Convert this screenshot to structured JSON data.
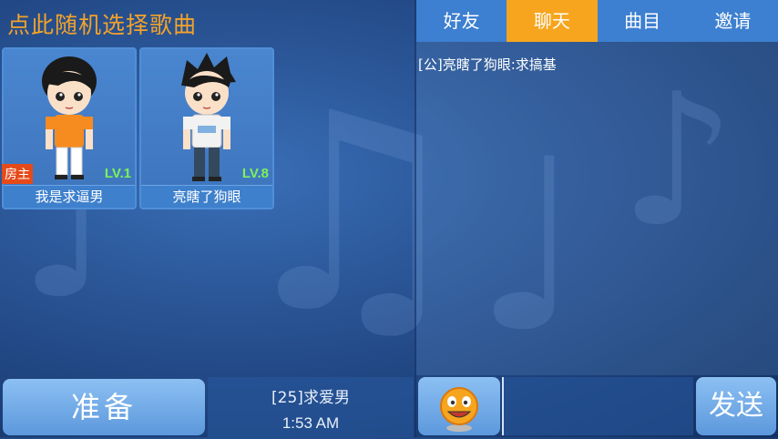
{
  "header": {
    "title": "点此随机选择歌曲"
  },
  "players": [
    {
      "name": "我是求逼男",
      "level": "LV.1",
      "badge": "房主"
    },
    {
      "name": "亮瞎了狗眼",
      "level": "LV.8",
      "badge": ""
    }
  ],
  "tabs": [
    {
      "label": "好友",
      "active": false
    },
    {
      "label": "聊天",
      "active": true
    },
    {
      "label": "曲目",
      "active": false
    },
    {
      "label": "邀请",
      "active": false
    }
  ],
  "chat": {
    "messages": [
      "[公]亮瞎了狗眼:求搞基"
    ]
  },
  "bottom": {
    "ready_label": "准备",
    "status_text": "[25]求爱男",
    "clock": "1:53 AM",
    "send_label": "发送",
    "input_value": ""
  },
  "colors": {
    "accent": "#f7a51e",
    "tab_bg": "#3d7fd0",
    "level": "#7cf25a",
    "host_badge": "#e64a19"
  },
  "icons": {
    "emoji": "smiley-face-icon"
  }
}
